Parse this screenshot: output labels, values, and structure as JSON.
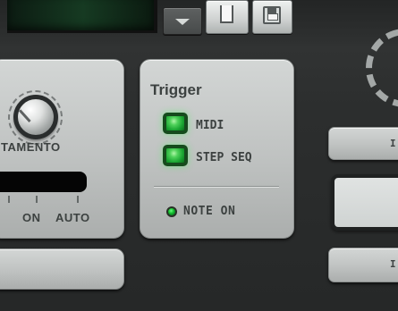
{
  "portamento": {
    "label": "TAMENTO",
    "modes": [
      "ON",
      "AUTO"
    ]
  },
  "trigger": {
    "title": "Trigger",
    "options": [
      {
        "label": "MIDI",
        "state": "on"
      },
      {
        "label": "STEP SEQ",
        "state": "on"
      }
    ],
    "indicator": {
      "label": "NOTE ON",
      "state": "on"
    }
  },
  "right_panel": {
    "top_label_fragment": "I",
    "bottom_label_fragment": "I"
  },
  "colors": {
    "panel": "#c2c5c4",
    "background": "#2b2d2d",
    "green": "#19a431",
    "green_glow": "#2eff49"
  }
}
